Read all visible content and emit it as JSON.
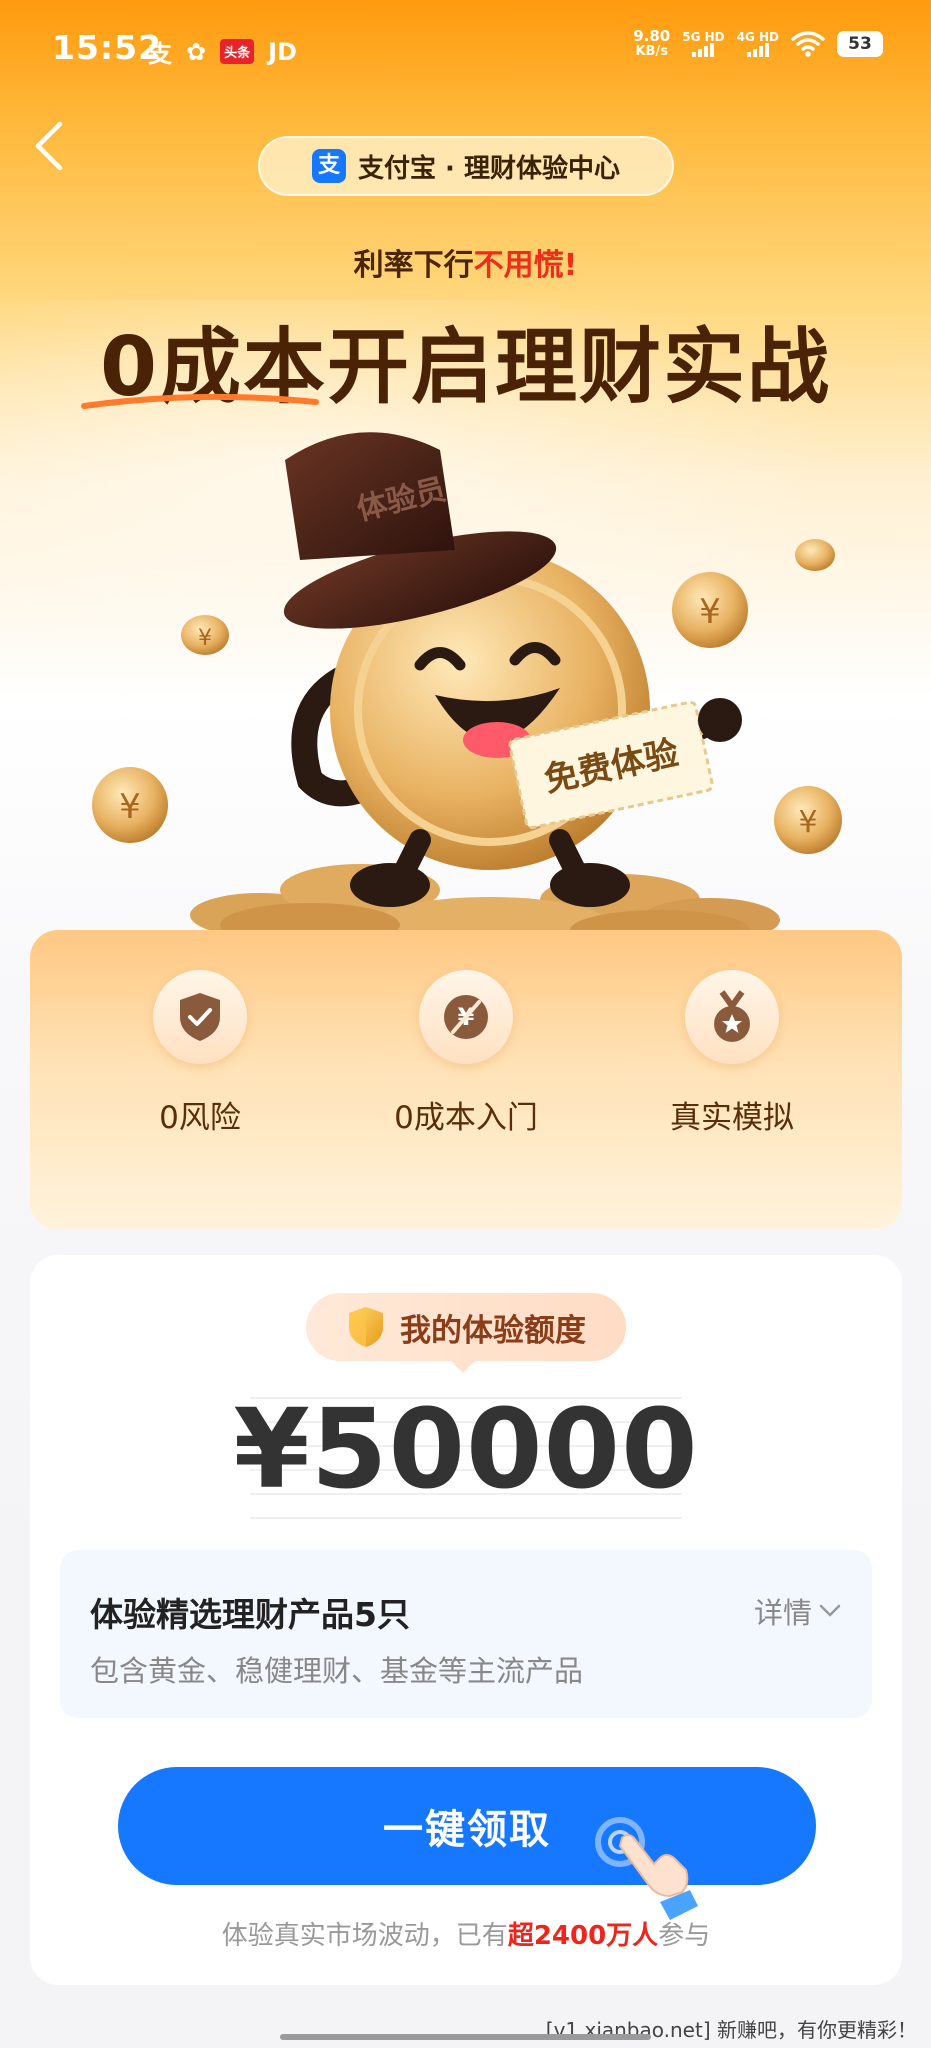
{
  "status_bar": {
    "time": "15:52",
    "notif_icons": [
      "支",
      "✿",
      "头条",
      "JD"
    ],
    "speed_top": "9.80",
    "speed_bottom": "KB/s",
    "net1": "5G HD",
    "net2": "4G HD",
    "battery": "53"
  },
  "header": {
    "logo_char": "支",
    "title": "支付宝 · 理财体验中心"
  },
  "hero": {
    "subtitle_prefix": "利率下行",
    "subtitle_highlight": "不用慌!",
    "headline": "0成本开启理财实战",
    "hat_text": "体验员",
    "ticket_text": "免费体验"
  },
  "features": [
    {
      "label": "0风险",
      "icon": "shield-check-icon"
    },
    {
      "label": "0成本入门",
      "icon": "no-cost-icon"
    },
    {
      "label": "真实模拟",
      "icon": "medal-icon"
    }
  ],
  "quota": {
    "label": "我的体验额度",
    "amount": "¥50000"
  },
  "product": {
    "title": "体验精选理财产品5只",
    "description": "包含黄金、稳健理财、基金等主流产品",
    "details_label": "详情"
  },
  "cta": {
    "button_label": "一键领取",
    "footnote_prefix": "体验真实市场波动，已有",
    "footnote_highlight": "超2400万人",
    "footnote_suffix": "参与"
  },
  "watermark": "[v1.xianbao.net] 新赚吧，有你更精彩！",
  "colors": {
    "primary_blue": "#1677ff",
    "highlight_red": "#f02d1b",
    "headline_brown": "#4a2306",
    "hero_orange": "#ff9a0e"
  }
}
